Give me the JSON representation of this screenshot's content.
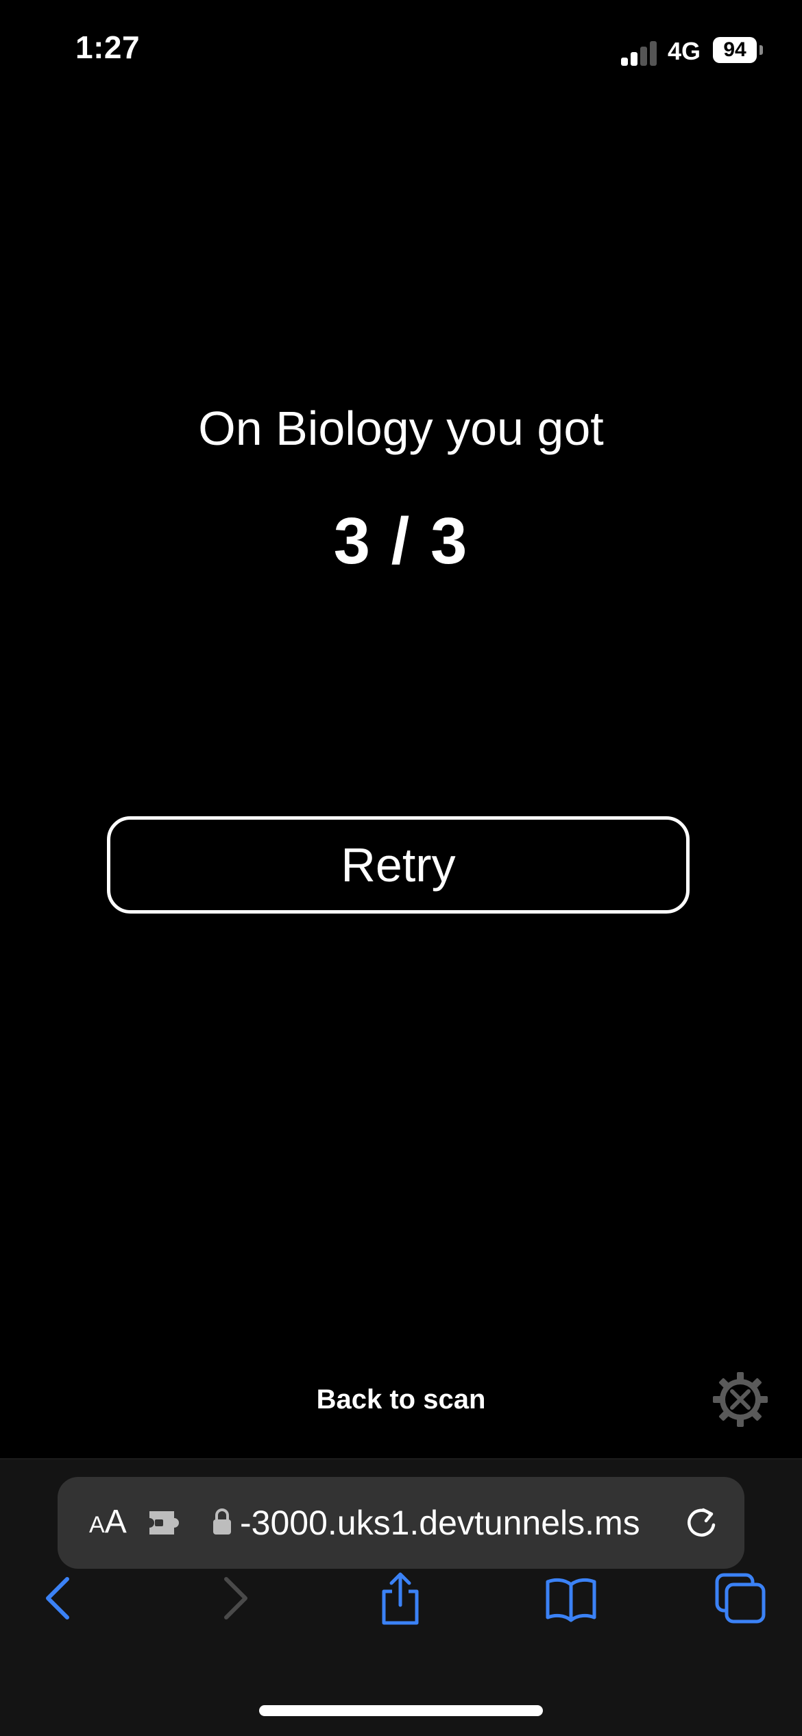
{
  "status_bar": {
    "time": "1:27",
    "network": "4G",
    "battery": "94"
  },
  "quiz_result": {
    "heading": "On Biology you got",
    "score": "3 / 3",
    "retry_label": "Retry",
    "back_label": "Back to scan"
  },
  "browser": {
    "aa_small": "A",
    "aa_large": "A",
    "url": "-3000.uks1.devtunnels.ms",
    "accent_color": "#3b82f6"
  },
  "icons": {
    "devtools": "devtools-gear-icon",
    "extension": "extension-icon",
    "lock": "lock-icon",
    "reload": "reload-icon",
    "back": "chevron-left-icon",
    "forward": "chevron-right-icon",
    "share": "share-icon",
    "bookmarks": "book-icon",
    "tabs": "tabs-icon"
  }
}
